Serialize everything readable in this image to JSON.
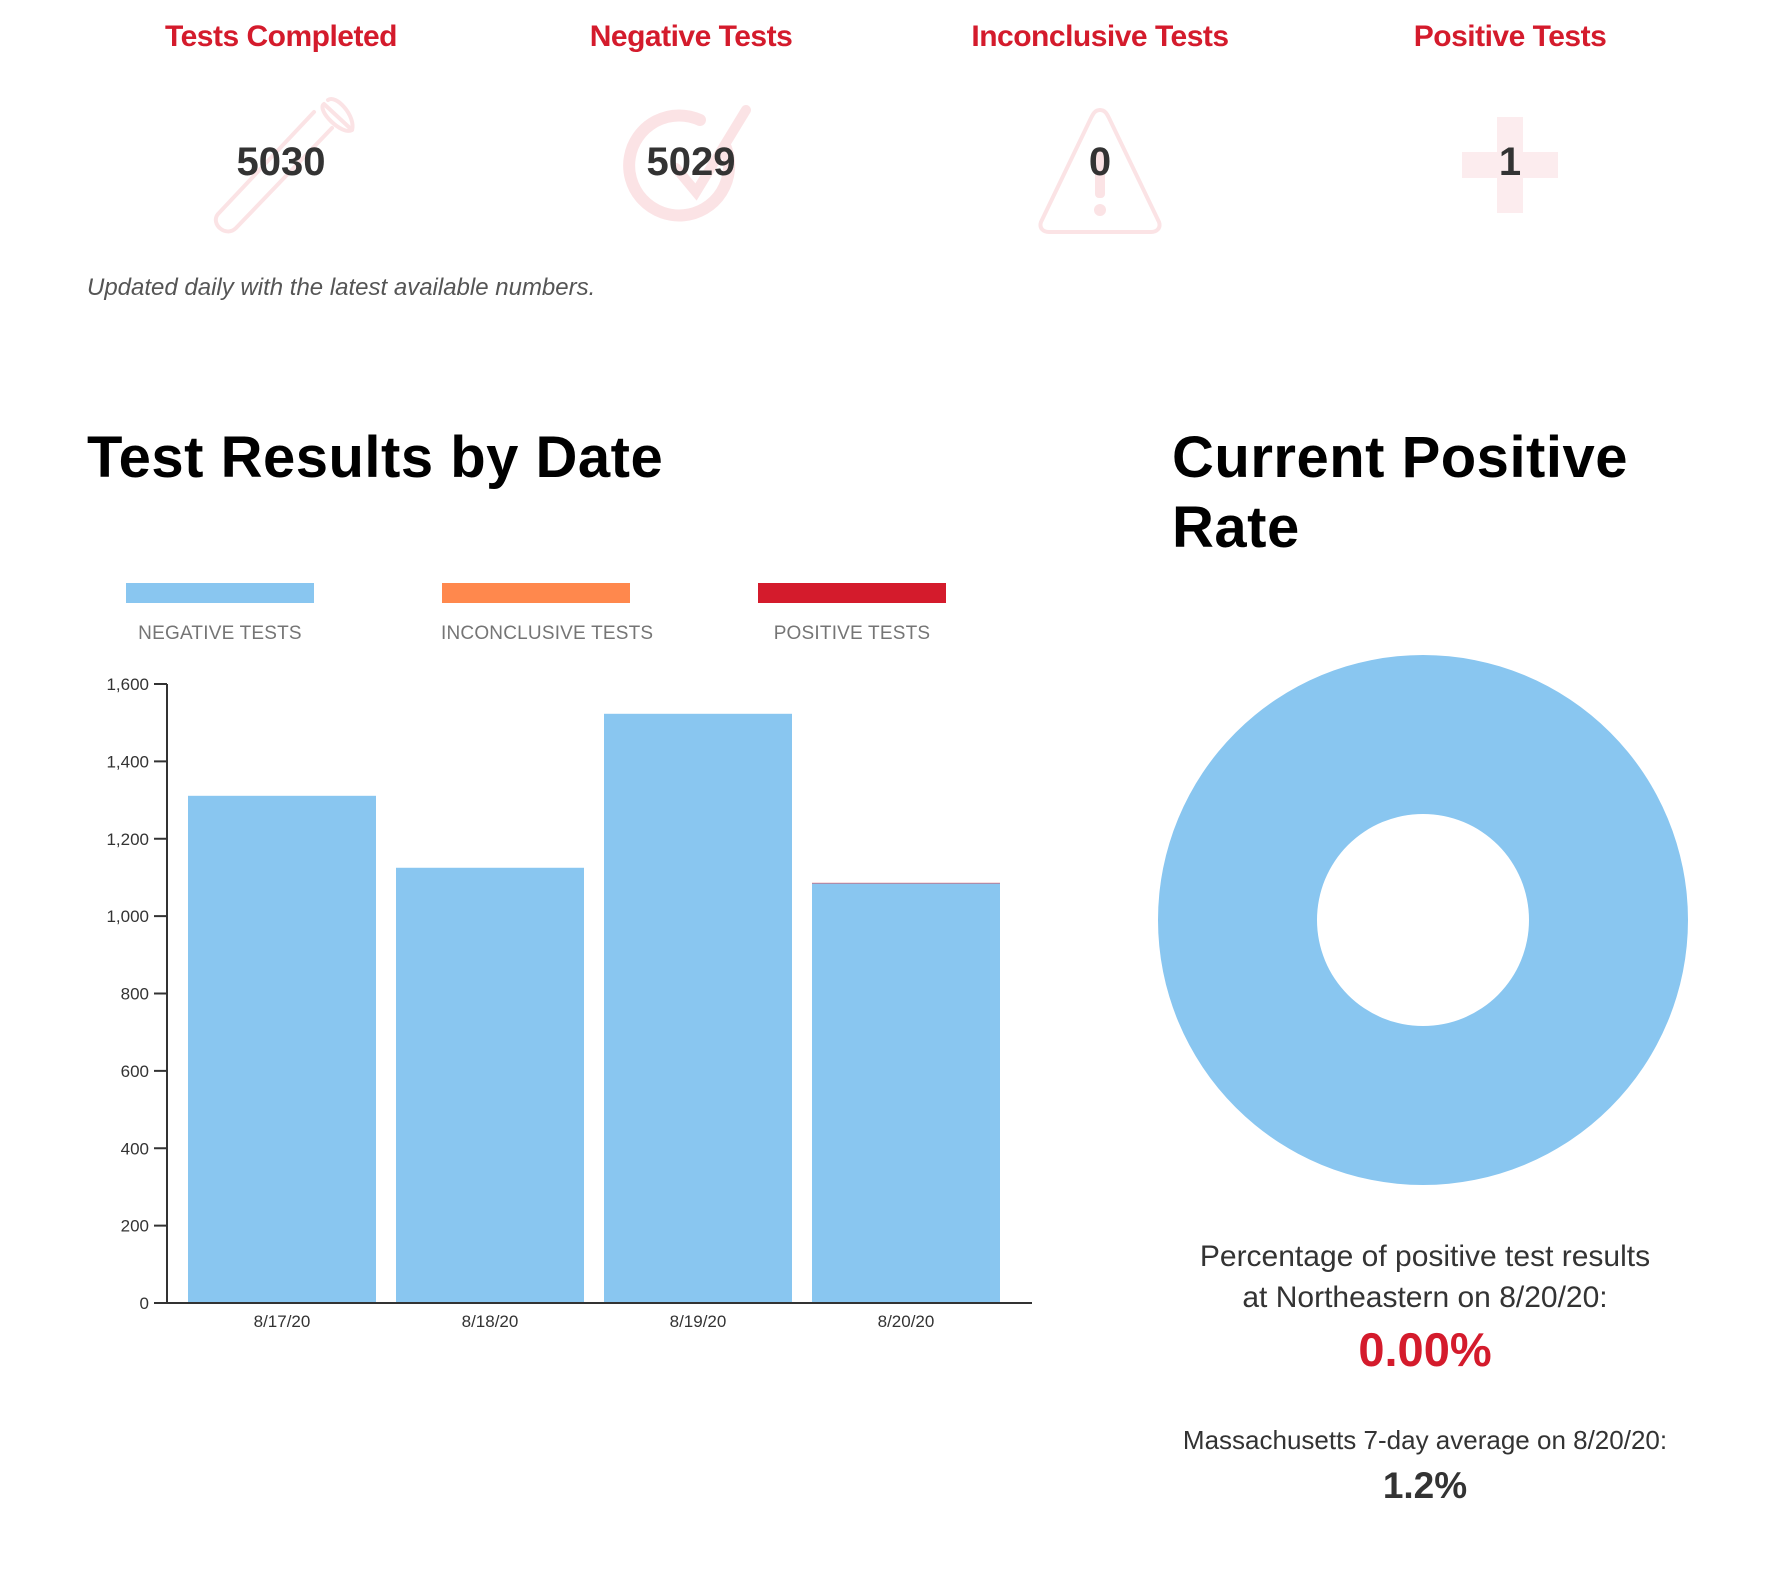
{
  "stats": [
    {
      "label": "Tests Completed",
      "value": "5030",
      "icon": "test-tube-icon"
    },
    {
      "label": "Negative Tests",
      "value": "5029",
      "icon": "check-circle-icon"
    },
    {
      "label": "Inconclusive Tests",
      "value": "0",
      "icon": "warning-triangle-icon"
    },
    {
      "label": "Positive Tests",
      "value": "1",
      "icon": "plus-cross-icon"
    }
  ],
  "updated_note": "Updated daily with the latest available numbers.",
  "bar_section": {
    "title": "Test Results by Date"
  },
  "rate_section": {
    "title_line1": "Current Positive",
    "title_line2": "Rate",
    "description_line1": "Percentage of positive test results",
    "description_line2": "at Northeastern on 8/20/20:",
    "rate_value": "0.00%",
    "ma_description": "Massachusetts 7-day average on 8/20/20:",
    "ma_value": "1.2%"
  },
  "colors": {
    "accent": "#d41b2c",
    "negative": "#89c6f0",
    "inconclusive": "#ff884d",
    "positive": "#d41b2c",
    "icon_tint": "#fbe3e5"
  },
  "chart_data": [
    {
      "type": "bar",
      "title": "Test Results by Date",
      "stacked": true,
      "categories": [
        "8/17/20",
        "8/18/20",
        "8/19/20",
        "8/20/20"
      ],
      "series": [
        {
          "name": "NEGATIVE TESTS",
          "color": "#89c6f0",
          "values": [
            1311,
            1125,
            1523,
            1085
          ]
        },
        {
          "name": "INCONCLUSIVE TESTS",
          "color": "#ff884d",
          "values": [
            0,
            0,
            0,
            0
          ]
        },
        {
          "name": "POSITIVE TESTS",
          "color": "#d41b2c",
          "values": [
            0,
            0,
            0,
            1
          ]
        }
      ],
      "xlabel": "",
      "ylabel": "",
      "ylim": [
        0,
        1600
      ],
      "yticks": [
        0,
        200,
        400,
        600,
        800,
        1000,
        1200,
        1400,
        1600
      ],
      "ytick_labels": [
        "0",
        "200",
        "400",
        "600",
        "800",
        "1,000",
        "1,200",
        "1,400",
        "1,600"
      ],
      "grid": false,
      "legend_position": "top"
    },
    {
      "type": "pie",
      "title": "Current Positive Rate",
      "donut": true,
      "labels": [
        "Negative",
        "Positive"
      ],
      "values": [
        100.0,
        0.0
      ],
      "colors": [
        "#89c6f0",
        "#d41b2c"
      ]
    }
  ]
}
